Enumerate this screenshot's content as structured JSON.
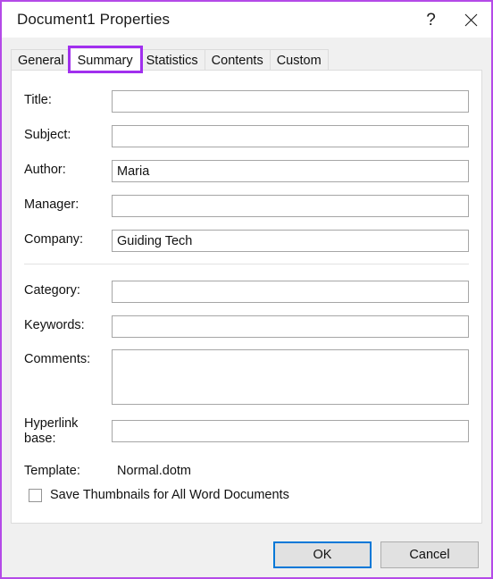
{
  "window": {
    "title": "Document1 Properties",
    "accent_highlight": "#a12fee",
    "focus_blue": "#0078d7",
    "help_label": "?",
    "close_label": "Close",
    "help_name": "help-button",
    "close_name": "close-button"
  },
  "tabs": [
    {
      "label": "General",
      "selected": false
    },
    {
      "label": "Summary",
      "selected": true
    },
    {
      "label": "Statistics",
      "selected": false
    },
    {
      "label": "Contents",
      "selected": false
    },
    {
      "label": "Custom",
      "selected": false
    }
  ],
  "form": {
    "fields": [
      {
        "label": "Title:",
        "value": "",
        "placeholder": ""
      },
      {
        "label": "Subject:",
        "value": "",
        "placeholder": ""
      },
      {
        "label": "Author:",
        "value": "Maria",
        "placeholder": ""
      },
      {
        "label": "Manager:",
        "value": "",
        "placeholder": ""
      },
      {
        "label": "Company:",
        "value": "Guiding Tech",
        "placeholder": ""
      },
      {
        "label": "Category:",
        "value": "",
        "placeholder": ""
      },
      {
        "label": "Keywords:",
        "value": "",
        "placeholder": ""
      },
      {
        "label": "Comments:",
        "value": "",
        "placeholder": ""
      },
      {
        "label": "Hyperlink base:",
        "value": "",
        "placeholder": ""
      }
    ],
    "template": {
      "label": "Template:",
      "value": "Normal.dotm"
    },
    "thumbnails_checkbox": {
      "label": "Save Thumbnails for All Word Documents",
      "checked": false
    }
  },
  "footer": {
    "ok_label": "OK",
    "cancel_label": "Cancel"
  }
}
